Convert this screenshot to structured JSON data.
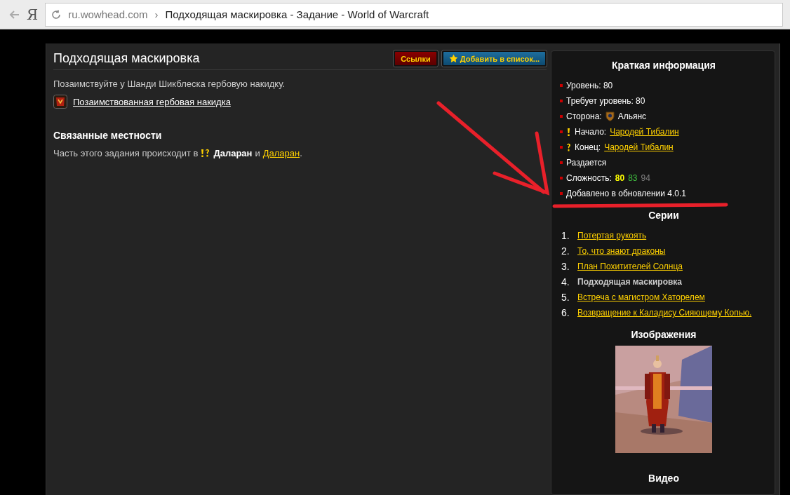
{
  "browser": {
    "domain": "ru.wowhead.com",
    "separator": "›",
    "title": "Подходящая маскировка - Задание - World of Warcraft",
    "logo": "Я"
  },
  "main": {
    "title": "Подходящая маскировка",
    "buttons": [
      {
        "label": "Ссылки",
        "kind": "links"
      },
      {
        "label": "Добавить в список...",
        "kind": "favorite"
      }
    ],
    "description": "Позаимствуйте у Шанди Шикблеска гербовую накидку.",
    "item": {
      "label": "Позаимствованная гербовая накидка"
    },
    "zones": {
      "heading": "Связанные местности",
      "prefix": "Часть этого задания происходит в",
      "first": "Даларан",
      "joiner": "и",
      "second": "Даларан",
      "suffix": "."
    }
  },
  "sidebar": {
    "quick_info": {
      "heading": "Краткая информация",
      "items": [
        {
          "kind": "text",
          "label": "Уровень: 80"
        },
        {
          "kind": "text",
          "label": "Требует уровень: 80"
        },
        {
          "kind": "faction",
          "label": "Сторона:",
          "value": "Альянс"
        },
        {
          "kind": "start",
          "label": "Начало:",
          "link": "Чародей Тибалин"
        },
        {
          "kind": "end",
          "label": "Конец:",
          "link": "Чародей Тибалин"
        },
        {
          "kind": "text",
          "label": "Раздается"
        },
        {
          "kind": "difficulty",
          "label": "Сложность:",
          "levels": [
            {
              "text": "80",
              "color": "#ffff00"
            },
            {
              "text": "83",
              "color": "#40bf40"
            },
            {
              "text": "94",
              "color": "#808080"
            }
          ]
        },
        {
          "kind": "text",
          "label": "Добавлено в обновлении 4.0.1"
        }
      ]
    },
    "series": {
      "heading": "Серии",
      "items": [
        {
          "number": "1.",
          "label": "Потертая рукоять",
          "selected": false
        },
        {
          "number": "2.",
          "label": "То, что знают драконы",
          "selected": false
        },
        {
          "number": "3.",
          "label": "План Похитителей Солнца",
          "selected": false
        },
        {
          "number": "4.",
          "label": "Подходящая маскировка",
          "selected": true
        },
        {
          "number": "5.",
          "label": "Встреча с магистром Хаторелем",
          "selected": false
        },
        {
          "number": "6.",
          "label": "Возвращение к Каладису Сияющему Копью.",
          "selected": false
        }
      ]
    },
    "screenshots": {
      "heading": "Изображения",
      "kind": "picture"
    },
    "video": {
      "heading": "Видео"
    }
  },
  "annotation": {
    "kind": "arrow"
  }
}
